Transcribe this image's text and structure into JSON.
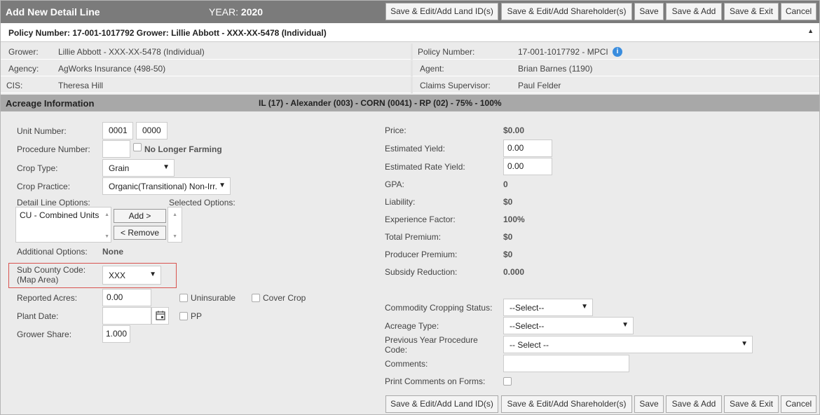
{
  "header": {
    "title": "Add New Detail Line",
    "year_label": "YEAR:",
    "year_value": "2020",
    "buttons": [
      "Save & Edit/Add Land ID(s)",
      "Save & Edit/Add Shareholder(s)",
      "Save",
      "Save & Add",
      "Save & Exit",
      "Cancel"
    ]
  },
  "policy_bar": {
    "text": "Policy Number: 17-001-1017792 Grower: Lillie Abbott - XXX-XX-5478 (Individual)",
    "collapse_icon": "triangle-up"
  },
  "info": {
    "grower_label": "Grower:",
    "grower_value": "Lillie Abbott - XXX-XX-5478 (Individual)",
    "policy_label": "Policy Number:",
    "policy_value": "17-001-1017792 - MPCI",
    "agency_label": "Agency:",
    "agency_value": "AgWorks Insurance (498-50)",
    "agent_label": "Agent:",
    "agent_value": "Brian Barnes (1190)",
    "cis_label": "CIS:",
    "cis_value": "Theresa Hill",
    "claims_label": "Claims Supervisor:",
    "claims_value": "Paul Felder"
  },
  "acreage": {
    "title": "Acreage Information",
    "subtitle": "IL (17) - Alexander (003) - CORN (0041) - RP (02) - 75% - 100%"
  },
  "left": {
    "unit_number_label": "Unit Number:",
    "unit_number_1": "0001",
    "unit_number_2": "0000",
    "procedure_number_label": "Procedure Number:",
    "no_longer_farming_label": "No Longer Farming",
    "crop_type_label": "Crop Type:",
    "crop_type_value": "Grain",
    "crop_practice_label": "Crop Practice:",
    "crop_practice_value": "Organic(Transitional) Non-Irr.",
    "detail_line_options_label": "Detail Line Options:",
    "selected_options_label": "Selected Options:",
    "detail_option_item": "CU - Combined Units",
    "add_button": "Add >",
    "remove_button": "< Remove",
    "additional_options_label": "Additional Options:",
    "additional_options_value": "None",
    "sub_county_label_1": "Sub County Code:",
    "sub_county_label_2": "(Map Area)",
    "sub_county_value": "XXX",
    "reported_acres_label": "Reported Acres:",
    "reported_acres_value": "0.00",
    "uninsurable_label": "Uninsurable",
    "cover_crop_label": "Cover Crop",
    "plant_date_label": "Plant Date:",
    "pp_label": "PP",
    "grower_share_label": "Grower Share:",
    "grower_share_value": "1.000"
  },
  "right": {
    "price_label": "Price:",
    "price_value": "$0.00",
    "estimated_yield_label": "Estimated Yield:",
    "estimated_yield_value": "0.00",
    "estimated_rate_yield_label": "Estimated Rate Yield:",
    "estimated_rate_yield_value": "0.00",
    "gpa_label": "GPA:",
    "gpa_value": "0",
    "liability_label": "Liability:",
    "liability_value": "$0",
    "experience_factor_label": "Experience Factor:",
    "experience_factor_value": "100%",
    "total_premium_label": "Total Premium:",
    "total_premium_value": "$0",
    "producer_premium_label": "Producer Premium:",
    "producer_premium_value": "$0",
    "subsidy_reduction_label": "Subsidy Reduction:",
    "subsidy_reduction_value": "0.000",
    "commodity_cropping_label": "Commodity Cropping Status:",
    "commodity_cropping_value": "--Select--",
    "acreage_type_label": "Acreage Type:",
    "acreage_type_value": "--Select--",
    "prev_year_label_1": "Previous Year Procedure",
    "prev_year_label_2": "Code:",
    "prev_year_value": "-- Select --",
    "comments_label": "Comments:",
    "print_comments_label": "Print Comments on Forms:"
  },
  "colors": {
    "titlebar": "#7b7b7b",
    "section_bar": "#a8a8a8",
    "highlight_border": "#d9534f",
    "info_icon": "#3a8dde"
  }
}
